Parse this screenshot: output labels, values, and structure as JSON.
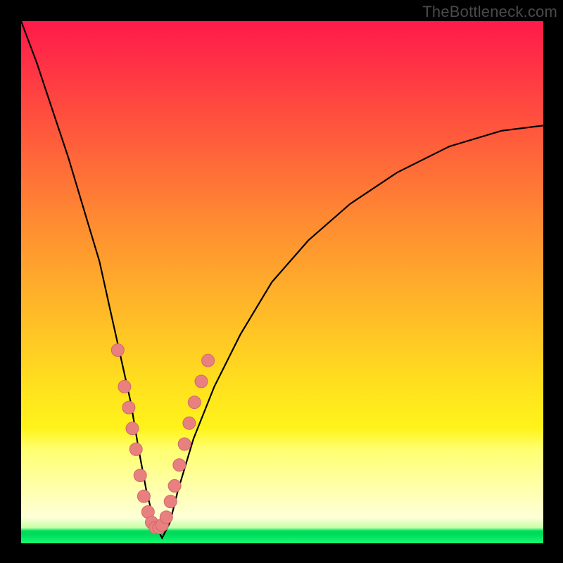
{
  "watermark": "TheBottleneck.com",
  "colors": {
    "frame": "#000000",
    "curve": "#000000",
    "marker_fill": "#e98080",
    "marker_stroke": "#d06868"
  },
  "chart_data": {
    "type": "line",
    "title": "",
    "xlabel": "",
    "ylabel": "",
    "xlim": [
      0,
      100
    ],
    "ylim": [
      0,
      100
    ],
    "grid": false,
    "legend": false,
    "note": "Bottleneck curve. x = relative component capability, y = bottleneck %. No axis tick labels are visible.",
    "series": [
      {
        "name": "bottleneck-curve",
        "x": [
          0,
          3,
          6,
          9,
          12,
          15,
          17,
          19,
          21,
          22.5,
          24,
          25.5,
          27,
          28.5,
          30,
          33,
          37,
          42,
          48,
          55,
          63,
          72,
          82,
          92,
          100
        ],
        "y": [
          100,
          92,
          83,
          74,
          64,
          54,
          45,
          36,
          27,
          18,
          10,
          4,
          1,
          4,
          10,
          20,
          30,
          40,
          50,
          58,
          65,
          71,
          76,
          79,
          80
        ]
      }
    ],
    "markers": {
      "name": "highlighted-points",
      "comment": "Salmon dots clustered around the V minimum",
      "points": [
        {
          "x": 18.5,
          "y": 37
        },
        {
          "x": 19.8,
          "y": 30
        },
        {
          "x": 20.6,
          "y": 26
        },
        {
          "x": 21.3,
          "y": 22
        },
        {
          "x": 22.0,
          "y": 18
        },
        {
          "x": 22.8,
          "y": 13
        },
        {
          "x": 23.5,
          "y": 9
        },
        {
          "x": 24.3,
          "y": 6
        },
        {
          "x": 25.0,
          "y": 4
        },
        {
          "x": 25.7,
          "y": 3
        },
        {
          "x": 26.4,
          "y": 3
        },
        {
          "x": 27.0,
          "y": 3.5
        },
        {
          "x": 27.8,
          "y": 5
        },
        {
          "x": 28.6,
          "y": 8
        },
        {
          "x": 29.4,
          "y": 11
        },
        {
          "x": 30.3,
          "y": 15
        },
        {
          "x": 31.3,
          "y": 19
        },
        {
          "x": 32.2,
          "y": 23
        },
        {
          "x": 33.2,
          "y": 27
        },
        {
          "x": 34.5,
          "y": 31
        },
        {
          "x": 35.8,
          "y": 35
        }
      ]
    }
  }
}
